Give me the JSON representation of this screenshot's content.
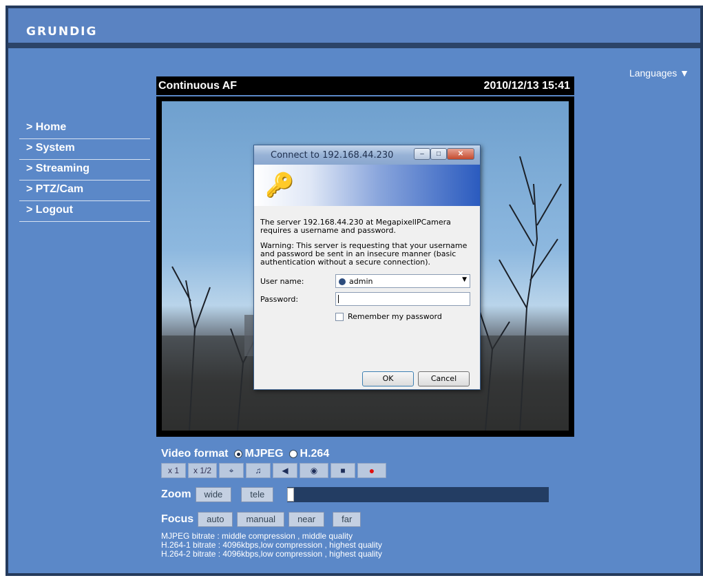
{
  "brand": {
    "logo": "GRUNDIG"
  },
  "languages": "Languages ▼",
  "nav": [
    {
      "label": "> Home"
    },
    {
      "label": "> System"
    },
    {
      "label": "> Streaming"
    },
    {
      "label": "> PTZ/Cam"
    },
    {
      "label": "> Logout"
    }
  ],
  "video": {
    "mode": "Continuous AF",
    "timestamp": "2010/12/13 15:41"
  },
  "dialog": {
    "title": "Connect to 192.168.44.230",
    "message": "The server 192.168.44.230 at MegapixelIPCamera requires a username and password.",
    "warning": "Warning: This server is requesting that your username and password be sent in an insecure manner (basic authentication without a secure connection).",
    "user_label": "User name:",
    "user_value": "admin",
    "password_label": "Password:",
    "remember_label": "Remember my password",
    "ok_label": "OK",
    "cancel_label": "Cancel"
  },
  "controls": {
    "video_format_label": "Video format",
    "format_options": [
      "MJPEG",
      "H.264"
    ],
    "selected_format": "MJPEG",
    "toolbar": {
      "x1": "x 1",
      "x_half": "x 1/2",
      "fullscreen_icon": "fullscreen-icon",
      "mic_icon": "microphone-icon",
      "speaker_icon": "speaker-icon",
      "snapshot_icon": "camera-icon",
      "stop_icon": "stop-icon",
      "record_icon": "record-icon"
    },
    "zoom_label": "Zoom",
    "zoom_wide": "wide",
    "zoom_tele": "tele",
    "zoom_level": 0,
    "focus_label": "Focus",
    "focus_auto": "auto",
    "focus_manual": "manual",
    "focus_near": "near",
    "focus_far": "far"
  },
  "bitrates": [
    "MJPEG bitrate : middle compression , middle quality",
    "H.264-1 bitrate : 4096kbps,low compression , highest quality",
    "H.264-2 bitrate : 4096kbps,low compression , highest quality"
  ]
}
